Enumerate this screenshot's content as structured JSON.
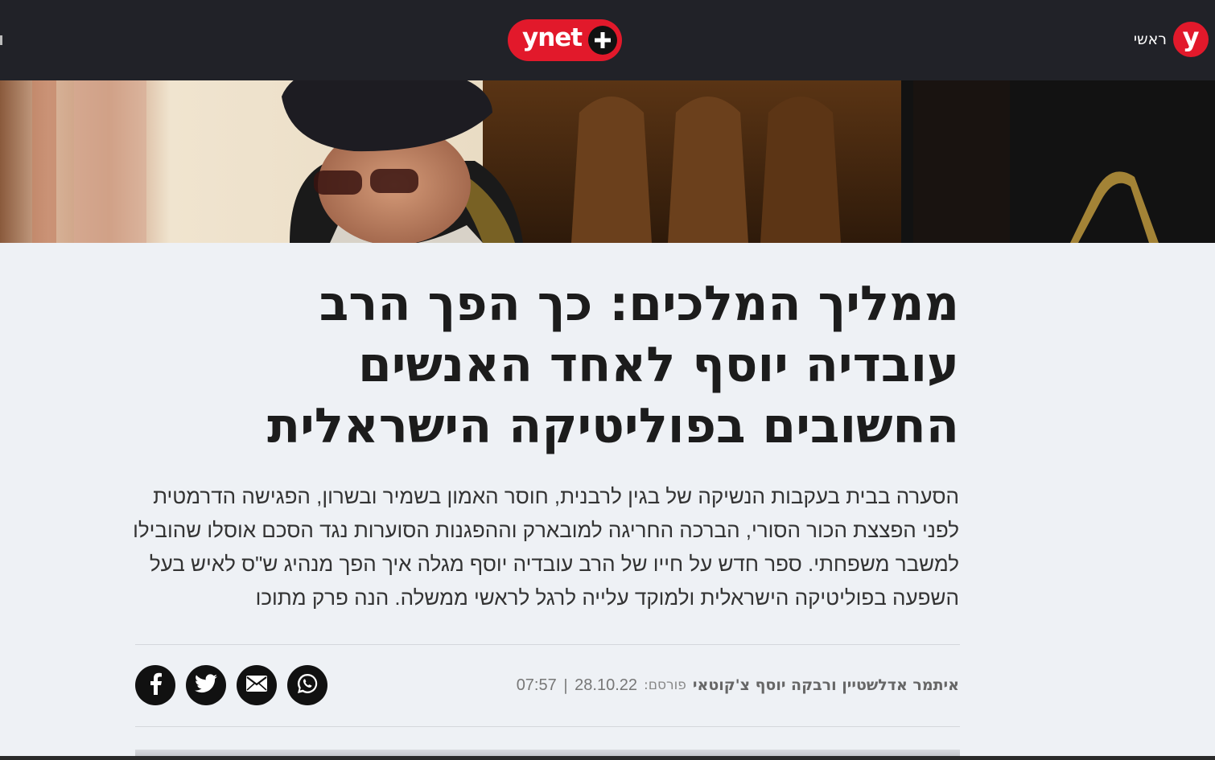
{
  "header": {
    "home_label": "ראשי",
    "y_logo": "y",
    "brand": "ynet",
    "brand_icon": "plus-icon",
    "colors": {
      "bar": "#212228",
      "brand_red": "#e2192b"
    }
  },
  "article": {
    "headline": "ממליך המלכים: כך הפך הרב עובדיה יוסף לאחד האנשים החשובים בפוליטיקה הישראלית",
    "subtitle": "הסערה בבית בעקבות הנשיקה של בגין לרבנית, חוסר האמון בשמיר ובשרון, הפגישה הדרמטית לפני הפצצת הכור הסורי, הברכה החריגה למובארק וההפגנות הסוערות נגד הסכם אוסלו שהובילו למשבר משפחתי. ספר חדש על חייו של הרב עובדיה יוסף מגלה איך הפך מנהיג ש\"ס לאיש בעל השפעה בפוליטיקה הישראלית ולמוקד עלייה לרגל לראשי ממשלה. הנה פרק מתוכו",
    "authors": "איתמר אדלשטיין ורבקה יוסף צ'קוטאי",
    "published_label": "פורסם:",
    "date": "28.10.22",
    "separator": "|",
    "time": "07:57"
  },
  "share": [
    {
      "name": "whatsapp-share-button",
      "icon": "whatsapp-icon"
    },
    {
      "name": "email-share-button",
      "icon": "email-icon"
    },
    {
      "name": "twitter-share-button",
      "icon": "twitter-icon"
    },
    {
      "name": "facebook-share-button",
      "icon": "facebook-icon"
    }
  ]
}
